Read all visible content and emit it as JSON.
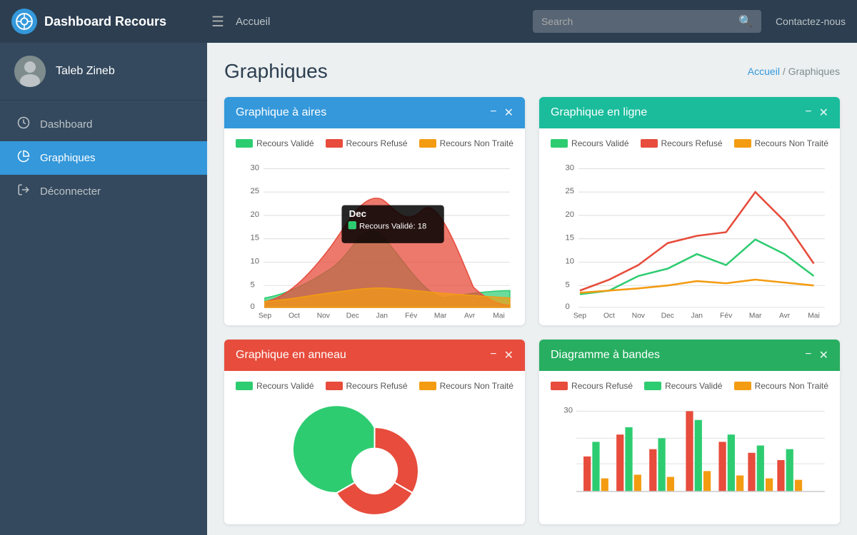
{
  "navbar": {
    "brand": "Dashboard Recours",
    "menu_icon": "☰",
    "accueil": "Accueil",
    "search_placeholder": "Search",
    "contact": "Contactez-nous"
  },
  "sidebar": {
    "user_name": "Taleb Zineb",
    "items": [
      {
        "label": "Dashboard",
        "icon": "🏎",
        "active": false
      },
      {
        "label": "Graphiques",
        "icon": "📊",
        "active": true
      },
      {
        "label": "Déconnecter",
        "icon": "➡",
        "active": false
      }
    ]
  },
  "page": {
    "title": "Graphiques",
    "breadcrumb_home": "Accueil",
    "breadcrumb_sep": " / ",
    "breadcrumb_current": "Graphiques"
  },
  "charts": [
    {
      "id": "aires",
      "title": "Graphique à aires",
      "header_class": "blue",
      "legend": [
        {
          "label": "Recours Validé",
          "color": "green"
        },
        {
          "label": "Recours Refusé",
          "color": "red"
        },
        {
          "label": "Recours Non Traité",
          "color": "orange"
        }
      ],
      "months": [
        "Sep",
        "Oct",
        "Nov",
        "Dec",
        "Jan",
        "Fév",
        "Mar",
        "Avr",
        "Mai"
      ],
      "tooltip": {
        "month": "Dec",
        "label": "Recours Validé: 18"
      },
      "show_tooltip": true
    },
    {
      "id": "ligne",
      "title": "Graphique en ligne",
      "header_class": "teal",
      "legend": [
        {
          "label": "Recours Validé",
          "color": "green"
        },
        {
          "label": "Recours Refusé",
          "color": "red"
        },
        {
          "label": "Recours Non Traité",
          "color": "orange"
        }
      ],
      "months": [
        "Sep",
        "Oct",
        "Nov",
        "Dec",
        "Jan",
        "Fév",
        "Mar",
        "Avr",
        "Mai"
      ],
      "show_tooltip": false
    },
    {
      "id": "anneau",
      "title": "Graphique en anneau",
      "header_class": "red",
      "legend": [
        {
          "label": "Recours Validé",
          "color": "green"
        },
        {
          "label": "Recours Refusé",
          "color": "red"
        },
        {
          "label": "Recours Non Traité",
          "color": "orange"
        }
      ],
      "show_tooltip": false
    },
    {
      "id": "bandes",
      "title": "Diagramme à bandes",
      "header_class": "green",
      "legend": [
        {
          "label": "Recours Refusé",
          "color": "red"
        },
        {
          "label": "Recours Validé",
          "color": "green"
        },
        {
          "label": "Recours Non Traité",
          "color": "orange"
        }
      ],
      "show_tooltip": false
    }
  ],
  "actions": {
    "minimize": "−",
    "close": "✕"
  }
}
